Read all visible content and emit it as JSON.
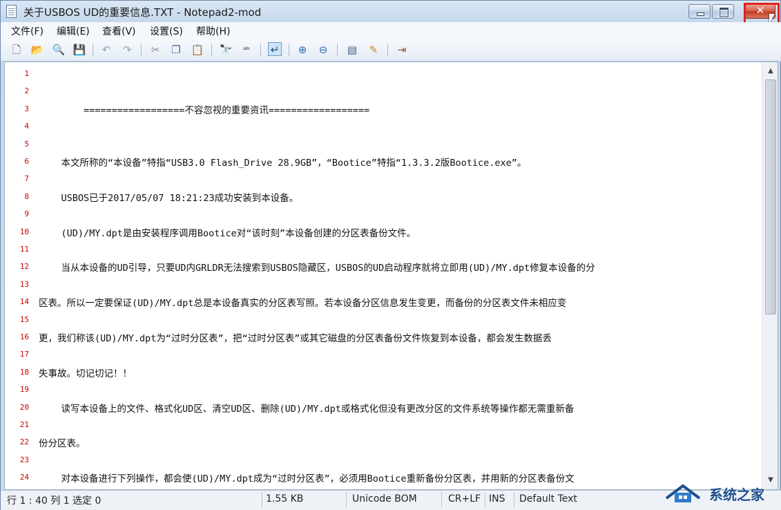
{
  "window": {
    "title": "关于USBOS UD的重要信息.TXT - Notepad2-mod",
    "close_label": "✕"
  },
  "menu": [
    "文件(F)",
    "编辑(E)",
    "查看(V)",
    "设置(S)",
    "帮助(H)"
  ],
  "toolbar_icons": [
    "new-file-icon",
    "open-folder-icon",
    "browse-icon",
    "save-icon",
    "undo-icon",
    "redo-icon",
    "cut-icon",
    "copy-icon",
    "paste-icon",
    "find-icon",
    "replace-icon",
    "word-wrap-icon",
    "zoom-in-icon",
    "zoom-out-icon",
    "scheme-icon",
    "customize-icon",
    "exit-icon"
  ],
  "editor": {
    "lines": [
      "",
      "",
      "        ==================不容忽视的重要资讯==================",
      "",
      "",
      "    本文所称的“本设备”特指“USB3.0 Flash_Drive 28.9GB”，“Bootice”特指“1.3.3.2版Bootice.exe”。",
      "",
      "    USBOS已于2017/05/07 18:21:23成功安装到本设备。",
      "",
      "    (UD)/MY.dpt是由安装程序调用Bootice对“该时刻”本设备创建的分区表备份文件。",
      "",
      "    当从本设备的UD引导，只要UD内GRLDR无法搜索到USBOS隐藏区，USBOS的UD启动程序就将立即用(UD)/MY.dpt修复本设备的分",
      "",
      "区表。所以一定要保证(UD)/MY.dpt总是本设备真实的分区表写照。若本设备分区信息发生变更，而备份的分区表文件未相应变",
      "",
      "更，我们称该(UD)/MY.dpt为“过时分区表”，把“过时分区表”或其它磁盘的分区表备份文件恢复到本设备，都会发生数据丢",
      "",
      "失事故。切记切记！！",
      "",
      "    读写本设备上的文件、格式化UD区、清空UD区、删除(UD)/MY.dpt或格式化但没有更改分区的文件系统等操作都无需重新备",
      "",
      "份分区表。",
      "",
      "    对本设备进行下列操作，都会使(UD)/MY.dpt成为“过时分区表”，必须用Bootice重新备份分区表，并用新的分区表备份文"
    ]
  },
  "status": {
    "position": "行 1 : 40   列 1   选定 0",
    "size": "1.55 KB",
    "encoding": "Unicode BOM",
    "eol": "CR+LF",
    "mode": "INS",
    "scheme": "Default Text"
  },
  "watermark": {
    "text": "系统之家"
  },
  "colors": {
    "line_numbers": "#cc0000",
    "highlight": "#e0231f"
  }
}
